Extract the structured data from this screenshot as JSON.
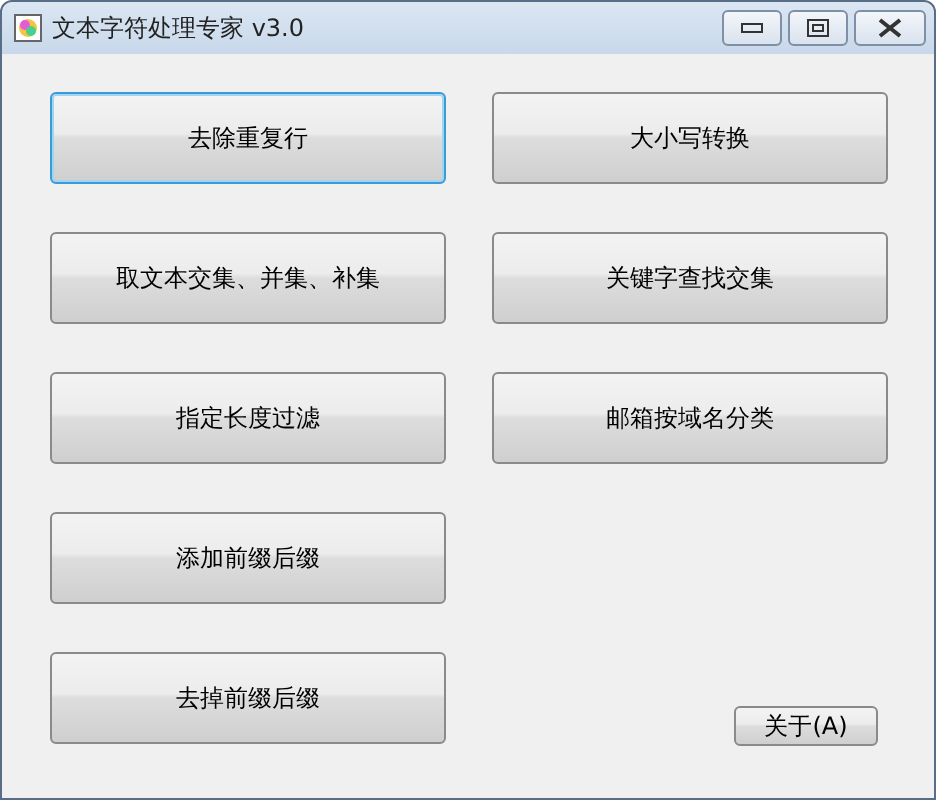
{
  "window": {
    "title": "文本字符处理专家 v3.0"
  },
  "left_buttons": [
    {
      "label": "去除重复行",
      "focused": true
    },
    {
      "label": "取文本交集、并集、补集",
      "focused": false
    },
    {
      "label": "指定长度过滤",
      "focused": false
    },
    {
      "label": "添加前缀后缀",
      "focused": false
    },
    {
      "label": "去掉前缀后缀",
      "focused": false
    }
  ],
  "right_buttons": [
    {
      "label": "大小写转换",
      "focused": false
    },
    {
      "label": "关键字查找交集",
      "focused": false
    },
    {
      "label": "邮箱按域名分类",
      "focused": false
    }
  ],
  "about_button": {
    "label": "关于(A)"
  }
}
